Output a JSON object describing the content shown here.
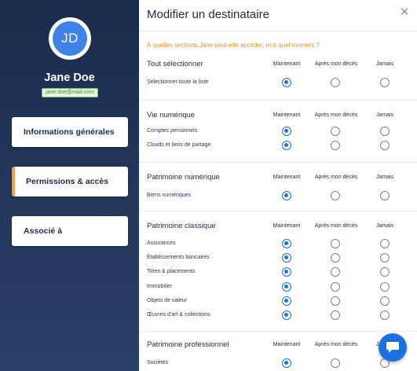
{
  "sidebar": {
    "avatar_initials": "JD",
    "user_name": "Jane Doe",
    "user_email": "jane.doe@mail.com",
    "nav": [
      {
        "label": "Informations générales",
        "active": false
      },
      {
        "label": "Permissions & accès",
        "active": true
      },
      {
        "label": "Associé à",
        "active": false
      }
    ]
  },
  "panel": {
    "title": "Modifier un destinataire",
    "question": "À quelles sections Jane peut-elle accéder, et à quel moment ?",
    "columns": {
      "now": "Maintenant",
      "after": "Après mon décès",
      "never": "Jamais"
    },
    "sections": [
      {
        "title": "Tout sélectionner",
        "rows": [
          {
            "label": "Sélectionner toute la liste",
            "selected": "now"
          }
        ]
      },
      {
        "title": "Vie numérique",
        "rows": [
          {
            "label": "Comptes personnels",
            "selected": "now"
          },
          {
            "label": "Clouds et liens de partage",
            "selected": "now"
          }
        ]
      },
      {
        "title": "Patrimoine numérique",
        "rows": [
          {
            "label": "Biens numériques",
            "selected": "now"
          }
        ]
      },
      {
        "title": "Patrimoine classique",
        "rows": [
          {
            "label": "Assurances",
            "selected": "now"
          },
          {
            "label": "Établissements bancaires",
            "selected": "now"
          },
          {
            "label": "Titres & placements",
            "selected": "now"
          },
          {
            "label": "Immobilier",
            "selected": "now"
          },
          {
            "label": "Objets de valeur",
            "selected": "now"
          },
          {
            "label": "Œuvres d'art & collections",
            "selected": "now"
          }
        ]
      },
      {
        "title": "Patrimoine professionnel",
        "rows": [
          {
            "label": "Sociétés",
            "selected": "now"
          }
        ]
      }
    ]
  },
  "icons": {
    "close": "close-icon",
    "chat": "chat-bubble-icon"
  },
  "colors": {
    "sidebar": "#1b2b4d",
    "accent": "#f0a23b",
    "radio_selected": "#1f6fe5",
    "question": "#e8902c",
    "email_badge": "#6cc15a"
  }
}
